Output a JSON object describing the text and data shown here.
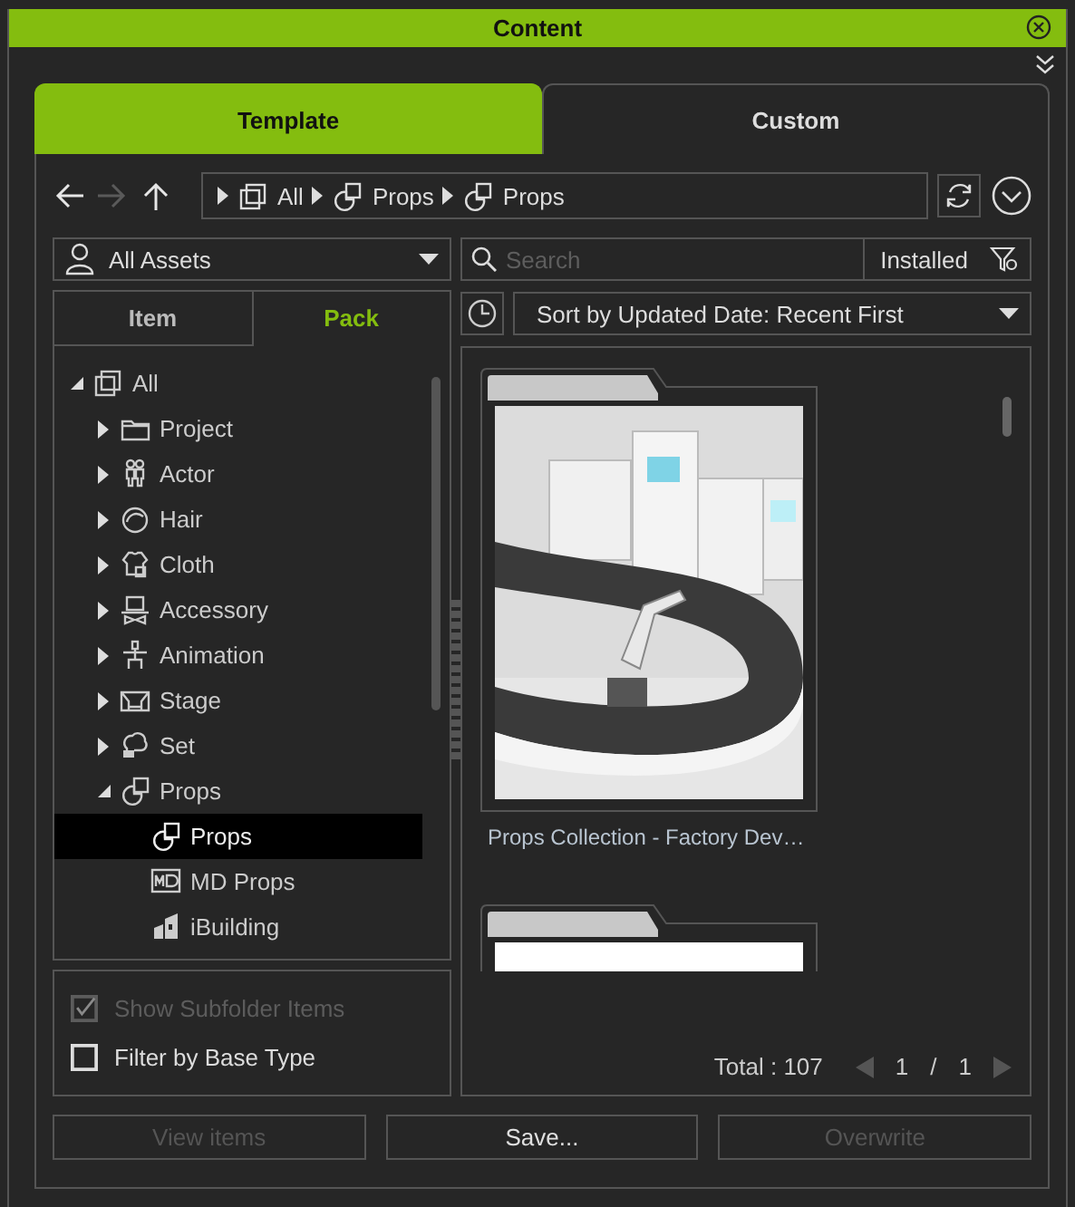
{
  "window": {
    "title": "Content"
  },
  "tabs": [
    {
      "label": "Template",
      "selected": true
    },
    {
      "label": "Custom",
      "selected": false
    }
  ],
  "nav_buttons": [
    {
      "kind": "back",
      "disabled": false
    },
    {
      "kind": "forward",
      "disabled": true
    },
    {
      "kind": "up",
      "disabled": false
    }
  ],
  "breadcrumb": [
    {
      "label": "All",
      "kind": "all"
    },
    {
      "label": "Props",
      "kind": "props"
    },
    {
      "label": "Props",
      "kind": "props"
    }
  ],
  "asset_filter": {
    "value": "All Assets"
  },
  "search": {
    "placeholder": "Search"
  },
  "installed_filter": {
    "label": "Installed"
  },
  "sort": {
    "value": "Sort by Updated Date: Recent First"
  },
  "view_tabs": [
    {
      "label": "Item",
      "selected": false
    },
    {
      "label": "Pack",
      "selected": true
    }
  ],
  "tree": [
    {
      "label": "All",
      "kind": "all",
      "expanded": true,
      "selected": false,
      "children": [
        {
          "label": "Project",
          "kind": "folder",
          "expanded": false,
          "selected": false
        },
        {
          "label": "Actor",
          "kind": "actor",
          "expanded": false,
          "selected": false
        },
        {
          "label": "Hair",
          "kind": "hair",
          "expanded": false,
          "selected": false
        },
        {
          "label": "Cloth",
          "kind": "cloth",
          "expanded": false,
          "selected": false
        },
        {
          "label": "Accessory",
          "kind": "accessory",
          "expanded": false,
          "selected": false
        },
        {
          "label": "Animation",
          "kind": "animation",
          "expanded": false,
          "selected": false
        },
        {
          "label": "Stage",
          "kind": "stage",
          "expanded": false,
          "selected": false
        },
        {
          "label": "Set",
          "kind": "set",
          "expanded": false,
          "selected": false
        },
        {
          "label": "Props",
          "kind": "props",
          "expanded": true,
          "selected": false,
          "children": [
            {
              "label": "Props",
              "kind": "props",
              "selected": true
            },
            {
              "label": "MD Props",
              "kind": "md",
              "selected": false
            },
            {
              "label": "iBuilding",
              "kind": "building",
              "selected": false
            }
          ]
        }
      ]
    }
  ],
  "options": [
    {
      "label": "Show Subfolder Items",
      "checked": true,
      "disabled": true
    },
    {
      "label": "Filter by Base Type",
      "checked": false,
      "disabled": false
    }
  ],
  "items": [
    {
      "kind": "picture",
      "title": "Props Collection - Factory Dev…"
    },
    {
      "kind": "blank"
    }
  ],
  "pager": {
    "total": "Total : 107",
    "page": "1",
    "separator": "/",
    "pages": "1",
    "prev_disabled": true,
    "next_disabled": true
  },
  "footer_buttons": [
    {
      "label": "View items",
      "disabled": true
    },
    {
      "label": "Save...",
      "disabled": false
    },
    {
      "label": "Overwrite",
      "disabled": true
    }
  ]
}
